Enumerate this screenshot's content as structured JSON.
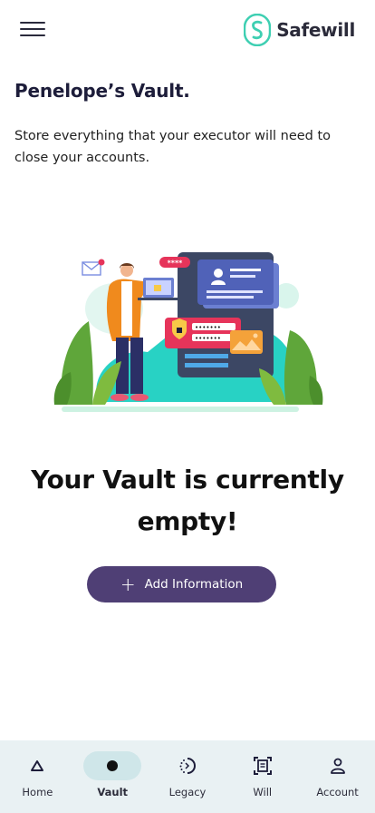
{
  "header": {
    "brand": "Safewill",
    "brand_color": "#3ecfb2",
    "menu_icon": "hamburger-icon"
  },
  "page": {
    "title": "Penelope’s Vault.",
    "subtitle": "Store everything that your executor will need to close your accounts."
  },
  "empty_state": {
    "illustration": "vault-security-illustration",
    "password_badge": "****",
    "message_line1": "Your Vault is currently",
    "message_line2": "empty!",
    "button_label": "Add Information",
    "button_color": "#4f3f75"
  },
  "nav": {
    "active": "Vault",
    "items": [
      {
        "label": "Home",
        "icon": "triangle-icon"
      },
      {
        "label": "Vault",
        "icon": "dot-icon"
      },
      {
        "label": "Legacy",
        "icon": "legacy-icon"
      },
      {
        "label": "Will",
        "icon": "document-icon"
      },
      {
        "label": "Account",
        "icon": "person-icon"
      }
    ]
  }
}
